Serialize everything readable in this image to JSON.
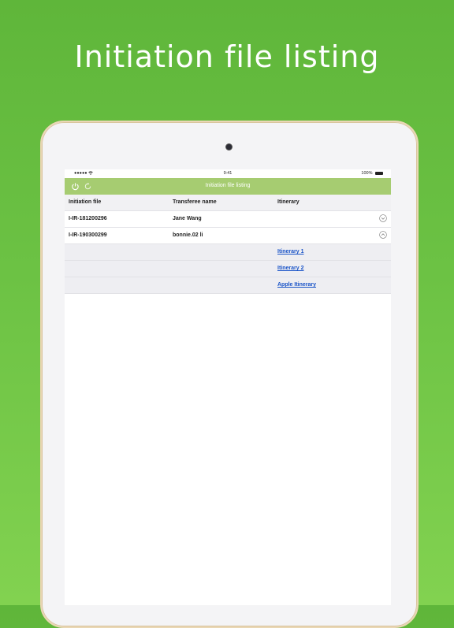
{
  "headline": "Initiation file listing",
  "status_bar": {
    "carrier": "●●●●● ",
    "time": "9:41",
    "battery": "100%"
  },
  "navbar": {
    "title": "Initiation file listing",
    "left_icons": [
      "power-icon",
      "refresh-icon"
    ]
  },
  "table": {
    "columns": [
      "Initiation file",
      "Transferee name",
      "Itinerary"
    ],
    "rows": [
      {
        "file": "I-IR-181200296",
        "name": "Jane Wang",
        "expanded": false
      },
      {
        "file": "I-IR-190300299",
        "name": "bonnie.02 li",
        "expanded": true
      }
    ],
    "itineraries": [
      "Itinerary 1",
      "Itinerary 2",
      "Apple Itinerary"
    ]
  },
  "colors": {
    "background": "#6cc244",
    "navbar": "#a6cc71",
    "link": "#1a54c8"
  }
}
